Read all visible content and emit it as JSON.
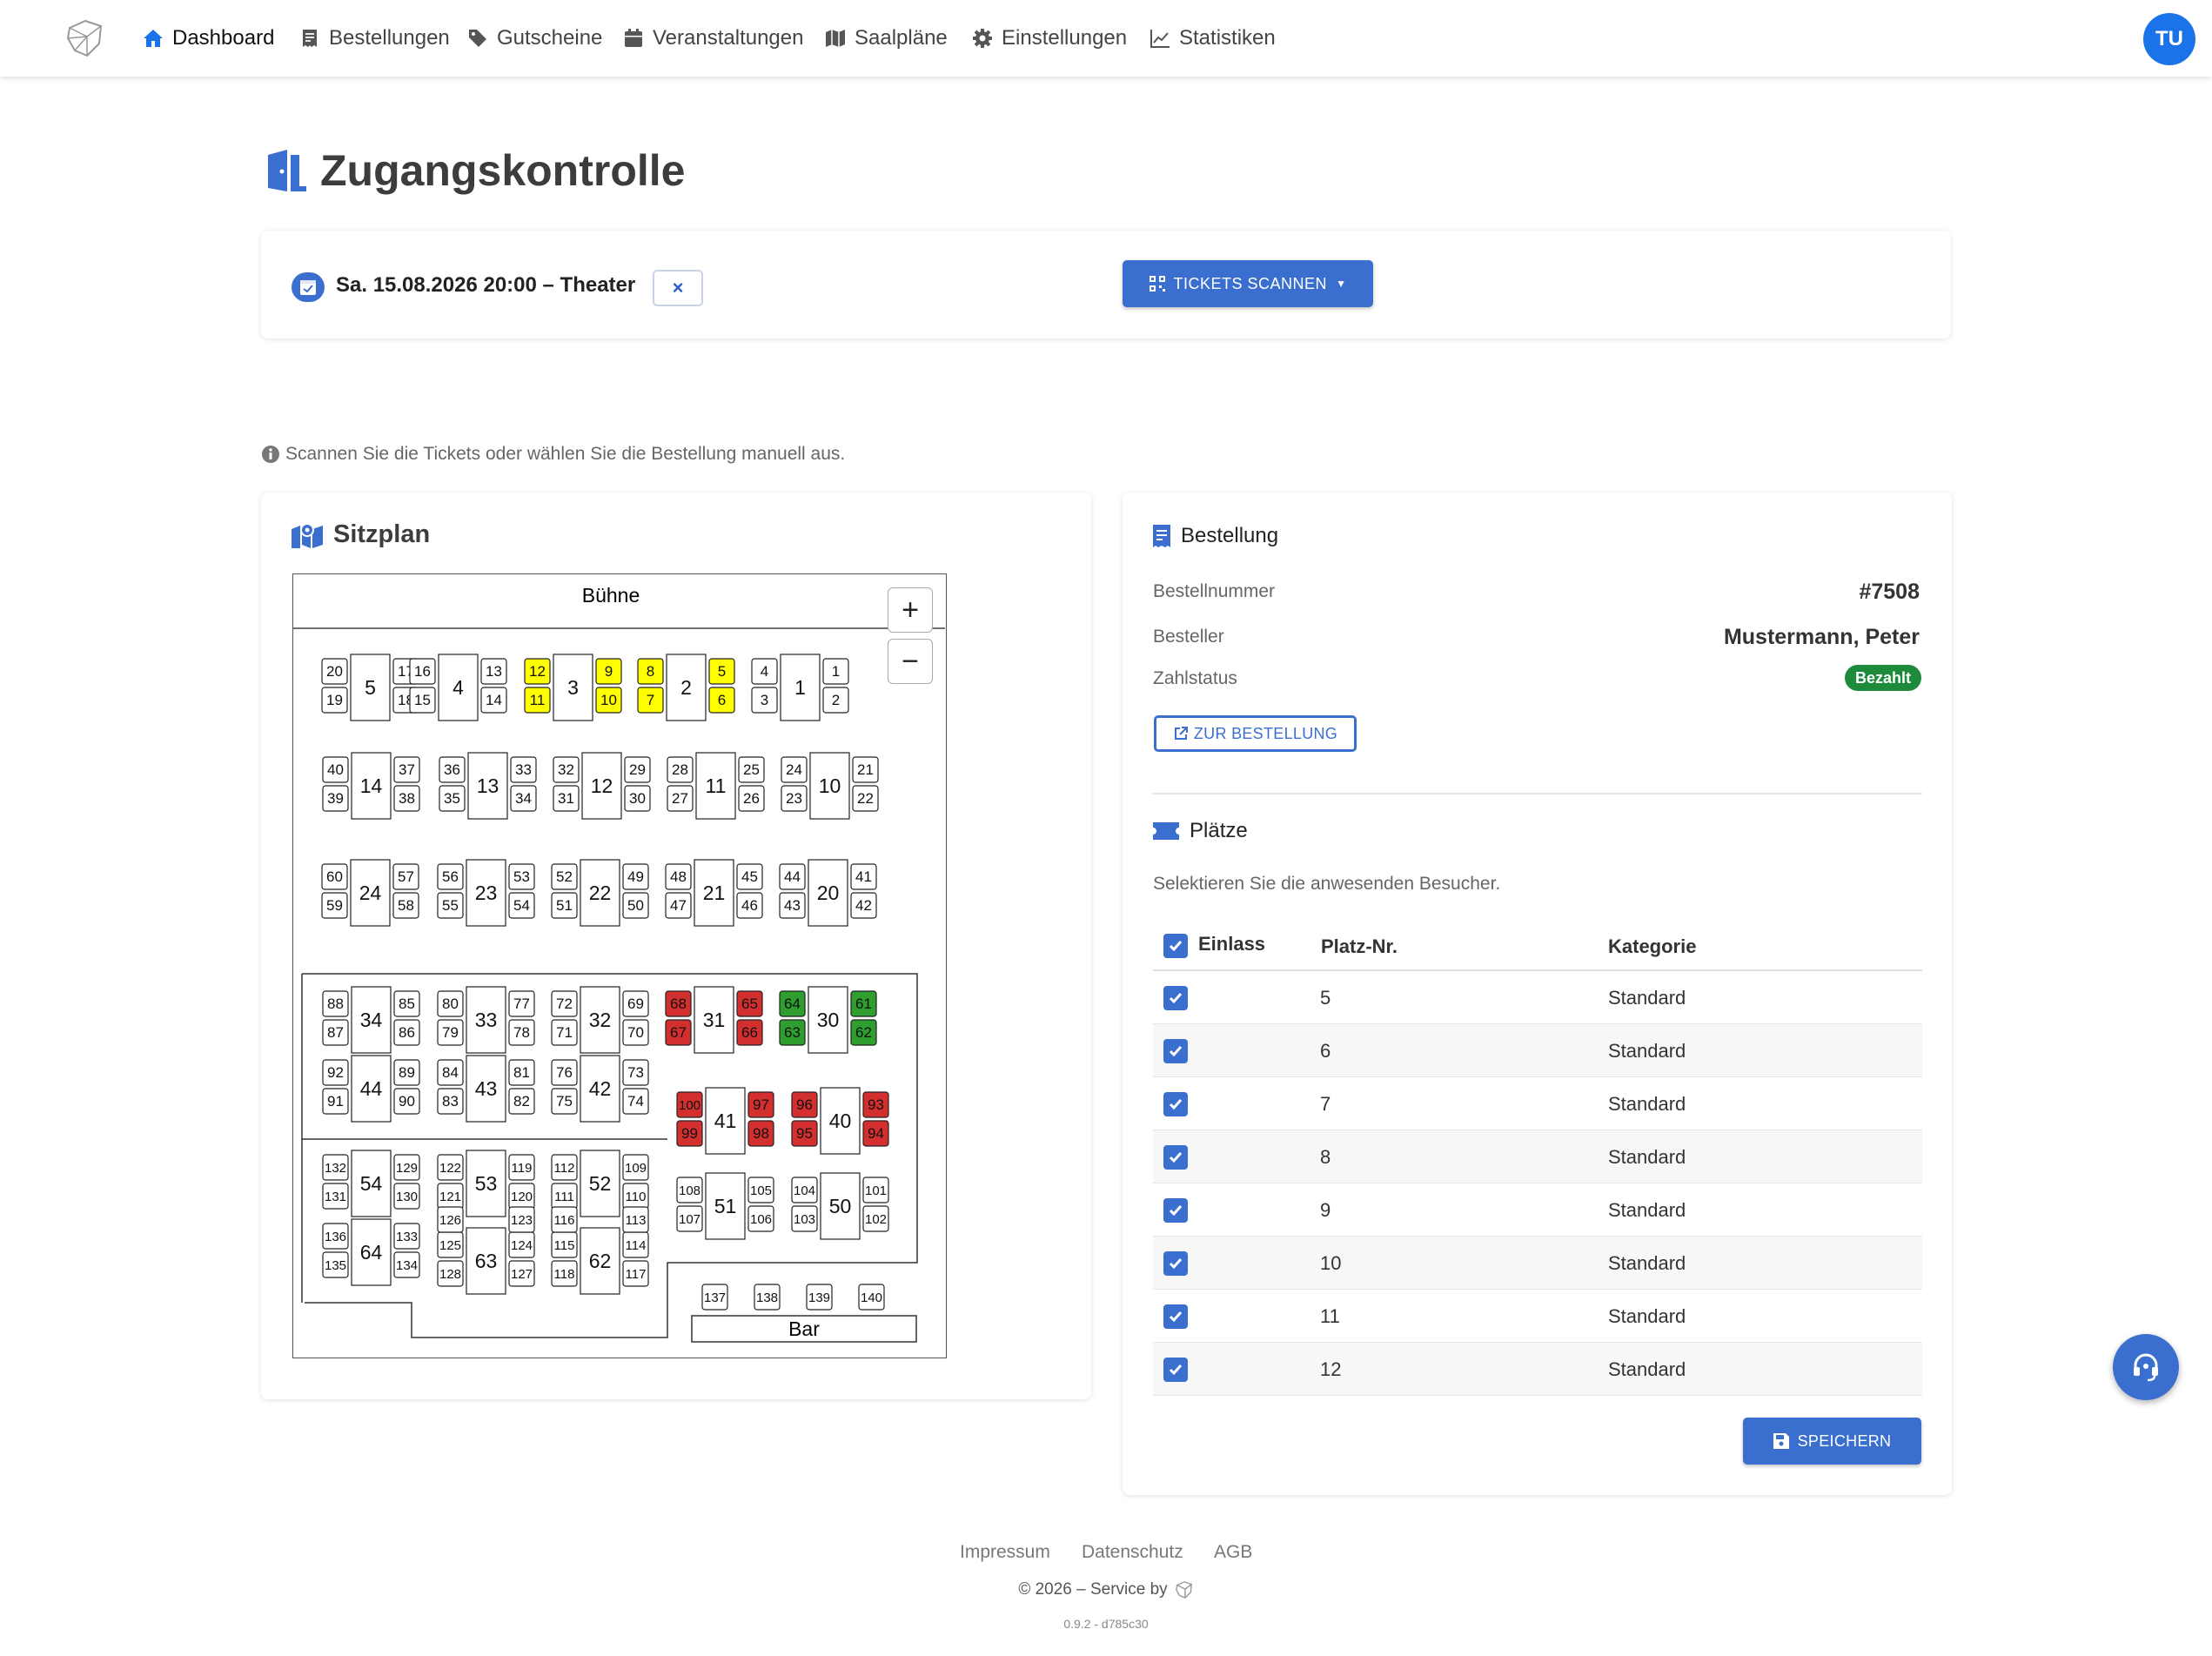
{
  "nav": {
    "items": [
      {
        "label": "Dashboard",
        "icon": "home-icon"
      },
      {
        "label": "Bestellungen",
        "icon": "receipt-icon"
      },
      {
        "label": "Gutscheine",
        "icon": "tag-icon"
      },
      {
        "label": "Veranstaltungen",
        "icon": "calendar-icon"
      },
      {
        "label": "Saalpläne",
        "icon": "map-icon"
      },
      {
        "label": "Einstellungen",
        "icon": "gear-icon"
      },
      {
        "label": "Statistiken",
        "icon": "chart-line-icon"
      }
    ],
    "avatar": "TU"
  },
  "page": {
    "title": "Zugangskontrolle"
  },
  "event": {
    "label": "Sa. 15.08.2026 20:00 – Theater",
    "clear": "×",
    "scan_button": "TICKETS SCANNEN"
  },
  "hint": "Scannen Sie die Tickets oder wählen Sie die Bestellung manuell aus.",
  "seating": {
    "title": "Sitzplan",
    "stage": "Bühne",
    "bar": "Bar",
    "zoom_in": "+",
    "zoom_out": "−",
    "colors": {
      "selected": "#ffff00",
      "occupied": "#d32f2f",
      "checked_in": "#2e9e2e",
      "free": "#ffffff"
    }
  },
  "order": {
    "title": "Bestellung",
    "number_label": "Bestellnummer",
    "number": "#7508",
    "customer_label": "Besteller",
    "customer": "Mustermann, Peter",
    "payment_label": "Zahlstatus",
    "payment": "Bezahlt",
    "link": "ZUR BESTELLUNG"
  },
  "seats": {
    "title": "Plätze",
    "subtitle": "Selektieren Sie die anwesenden Besucher.",
    "headers": {
      "entry": "Einlass",
      "seat": "Platz-Nr.",
      "category": "Kategorie"
    },
    "rows": [
      {
        "seat": "5",
        "category": "Standard"
      },
      {
        "seat": "6",
        "category": "Standard"
      },
      {
        "seat": "7",
        "category": "Standard"
      },
      {
        "seat": "8",
        "category": "Standard"
      },
      {
        "seat": "9",
        "category": "Standard"
      },
      {
        "seat": "10",
        "category": "Standard"
      },
      {
        "seat": "11",
        "category": "Standard"
      },
      {
        "seat": "12",
        "category": "Standard"
      }
    ],
    "save": "SPEICHERN"
  },
  "footer": {
    "links": [
      "Impressum",
      "Datenschutz",
      "AGB"
    ],
    "copyright": "© 2026 – Service by",
    "version": "0.9.2 - d785c30"
  },
  "colors": {
    "accent": "#3a6fcf",
    "nav_active": "#1a73e8",
    "paid": "#1e8a3c"
  }
}
